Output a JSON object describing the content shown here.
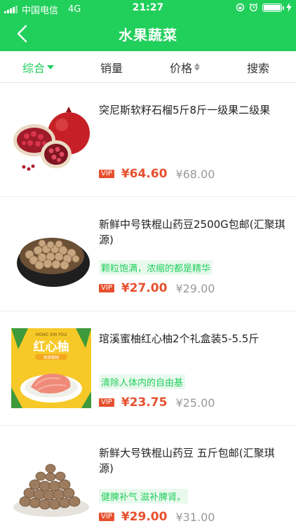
{
  "status_bar": {
    "carrier": "中国电信",
    "network": "4G",
    "time": "21:27"
  },
  "header": {
    "title": "水果蔬菜"
  },
  "sort_bar": {
    "items": [
      {
        "label": "综合",
        "active": true
      },
      {
        "label": "销量",
        "active": false
      },
      {
        "label": "价格",
        "active": false
      },
      {
        "label": "搜索",
        "active": false
      }
    ]
  },
  "colors": {
    "brand_green": "#21cf5b",
    "price_red": "#e6502e"
  },
  "products": [
    {
      "name": "突尼斯软籽石榴5斤8斤一级果二级果",
      "tag": "",
      "vip": "VIP",
      "price": "¥64.60",
      "original_price": "¥68.00",
      "image": "pomegranate"
    },
    {
      "name": "新鲜中号铁棍山药豆2500G包邮(汇聚琪源)",
      "tag": "颗粒饱满，浓缩的都是精华",
      "vip": "VIP",
      "price": "¥27.00",
      "original_price": "¥29.00",
      "image": "yam-beans-bowl"
    },
    {
      "name": "琯溪蜜柚红心柚2个礼盒装5-5.5斤",
      "tag": "清除人体内的自由基",
      "vip": "VIP",
      "price": "¥23.75",
      "original_price": "¥25.00",
      "image": "red-pomelo",
      "image_text": {
        "top": "HONG XIN YOU",
        "title": "红心柚",
        "sub": "琯溪蜜柚"
      }
    },
    {
      "name": "新鲜大号铁棍山药豆 五斤包邮(汇聚琪源)",
      "tag": "健脾补气 滋补脾肾。",
      "vip": "VIP",
      "price": "¥29.00",
      "original_price": "¥31.00",
      "image": "yam-beans-pile"
    }
  ]
}
